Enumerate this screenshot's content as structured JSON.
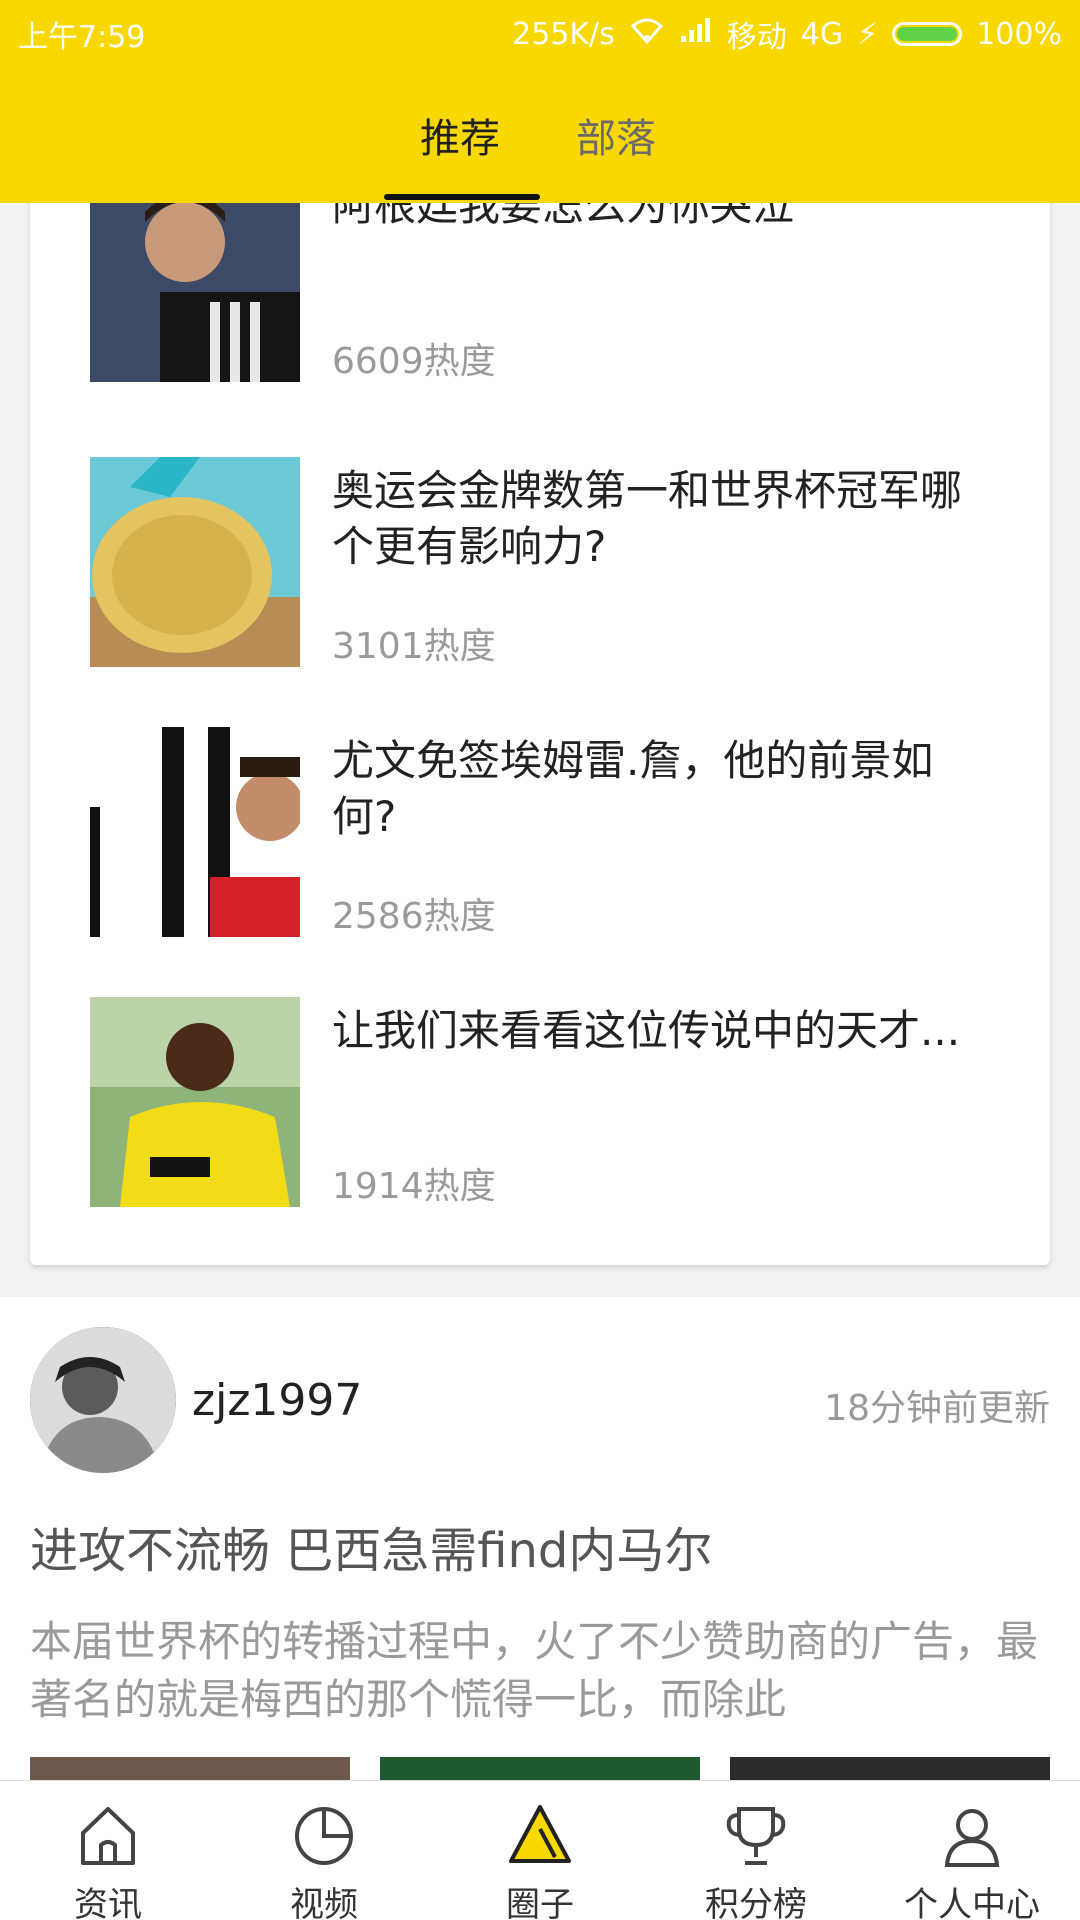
{
  "status_bar": {
    "time": "上午7:59",
    "speed": "255K/s",
    "carrier": "移动",
    "network": "4G",
    "battery": "100%",
    "accent": "#5fd24a"
  },
  "header": {
    "background": "#f9d800",
    "tabs": [
      {
        "label": "推荐",
        "selected": true
      },
      {
        "label": "部落",
        "selected": false
      }
    ]
  },
  "list": {
    "items": [
      {
        "title": "阿根廷我要怎么为你哭泣",
        "heat": "6609热度",
        "thumb": "messi-photo"
      },
      {
        "title": "奥运会金牌数第一和世界杯冠军哪个更有影响力?",
        "heat": "3101热度",
        "thumb": "gold-medal-photo"
      },
      {
        "title": "尤文免签埃姆雷.詹，他的前景如何?",
        "heat": "2586热度",
        "thumb": "juventus-player-photo"
      },
      {
        "title": "让我们来看看这位传说中的天才...",
        "heat": "1914热度",
        "thumb": "young-player-photo"
      }
    ]
  },
  "post": {
    "username": "zjz1997",
    "updated": "18分钟前更新",
    "title": "进攻不流畅 巴西急需find内马尔",
    "body": "本届世界杯的转播过程中，火了不少赞助商的广告，最著名的就是梅西的那个慌得一比，而除此"
  },
  "bottom_nav": [
    {
      "label": "资讯",
      "icon": "home-icon"
    },
    {
      "label": "视频",
      "icon": "pie-icon"
    },
    {
      "label": "圈子",
      "icon": "triangle-icon",
      "active": true
    },
    {
      "label": "积分榜",
      "icon": "trophy-icon"
    },
    {
      "label": "个人中心",
      "icon": "user-icon"
    }
  ]
}
